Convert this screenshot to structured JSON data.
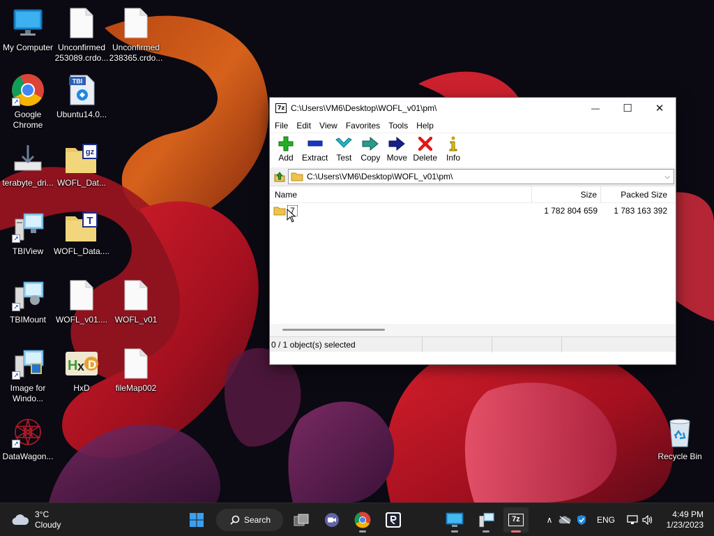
{
  "desktop": {
    "icons": [
      {
        "label": "My Computer"
      },
      {
        "label": "Unconfirmed 253089.crdo..."
      },
      {
        "label": "Unconfirmed 238365.crdo..."
      },
      {
        "label": "Google Chrome"
      },
      {
        "label": "Ubuntu14.0..."
      },
      {
        "label": "terabyte_dri..."
      },
      {
        "label": "WOFL_Dat..."
      },
      {
        "label": "TBIView"
      },
      {
        "label": "WOFL_Data...."
      },
      {
        "label": "TBIMount"
      },
      {
        "label": "WOFL_v01...."
      },
      {
        "label": "WOFL_v01"
      },
      {
        "label": "Image for Windo..."
      },
      {
        "label": "HxD"
      },
      {
        "label": "fileMap002"
      },
      {
        "label": "DataWagon..."
      },
      {
        "label": "Recycle Bin"
      }
    ],
    "badges": {
      "tbi": "TBI",
      "gz": "gz",
      "t": "T",
      "sevenzip_small": "7z"
    }
  },
  "window": {
    "title": "C:\\Users\\VM6\\Desktop\\WOFL_v01\\pm\\",
    "controls": {
      "minimize": "—",
      "maximize": "☐",
      "close": "✕"
    },
    "menu": [
      "File",
      "Edit",
      "View",
      "Favorites",
      "Tools",
      "Help"
    ],
    "toolbar": [
      "Add",
      "Extract",
      "Test",
      "Copy",
      "Move",
      "Delete",
      "Info"
    ],
    "address": "C:\\Users\\VM6\\Desktop\\WOFL_v01\\pm\\",
    "columns": {
      "name": "Name",
      "size": "Size",
      "packed": "Packed Size"
    },
    "rows": [
      {
        "name": "7",
        "size": "1 782 804 659",
        "packed": "1 783 163 392"
      }
    ],
    "status": "0 / 1 object(s) selected"
  },
  "taskbar": {
    "weather": {
      "temp": "3°C",
      "condition": "Cloudy"
    },
    "search_label": "Search",
    "language": "ENG",
    "time": "4:49 PM",
    "date": "1/23/2023",
    "app_7z_label": "7z"
  }
}
